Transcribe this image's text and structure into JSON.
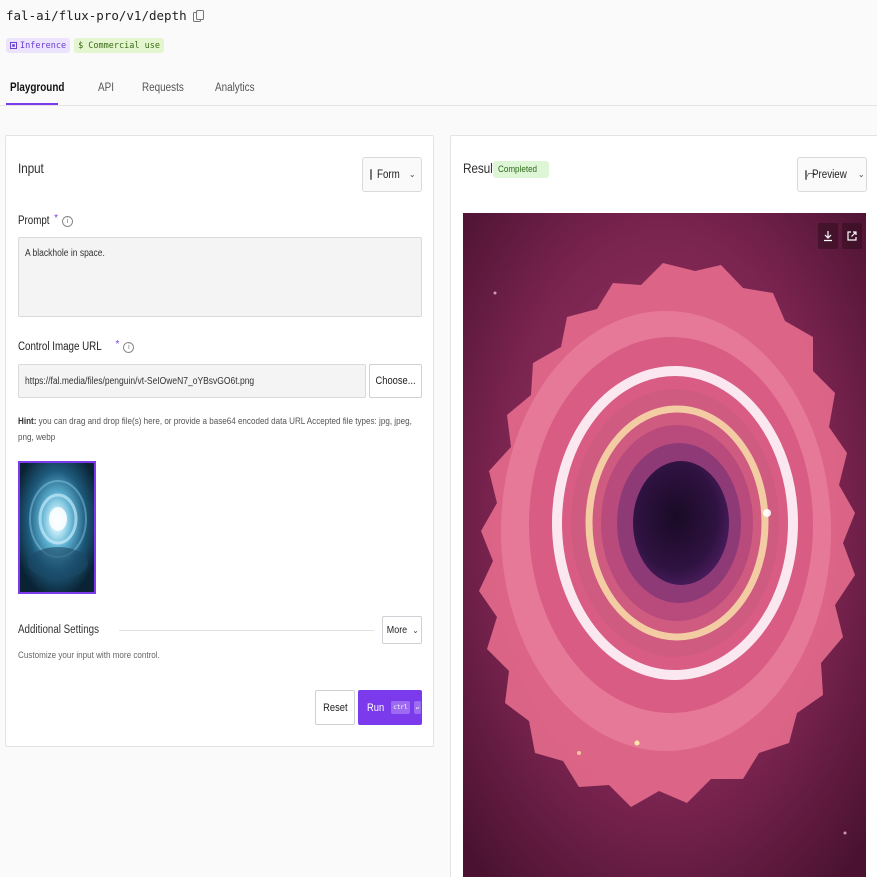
{
  "header": {
    "model_id": "fal-ai/flux-pro/v1/depth",
    "badges": {
      "inference": "Inference",
      "commercial": "$ Commercial use"
    },
    "tabs": [
      "Playground",
      "API",
      "Requests",
      "Analytics"
    ],
    "active_tab": "Playground"
  },
  "input": {
    "title": "Input",
    "view_select": "Form",
    "prompt": {
      "label": "Prompt",
      "required_mark": "*",
      "value": "A blackhole in space."
    },
    "control_image": {
      "label": "Control Image URL",
      "required_mark": "*",
      "value": "https://fal.media/files/penguin/vt-SeIOweN7_oYBsvGO6t.png",
      "choose_label": "Choose..."
    },
    "hint": {
      "bold": "Hint:",
      "text": " you can drag and drop file(s) here, or provide a base64 encoded data URL Accepted file types: jpg, jpeg, png, webp"
    },
    "additional_settings": {
      "label": "Additional Settings",
      "more_label": "More",
      "description": "Customize your input with more control."
    },
    "reset_label": "Reset",
    "run_label": "Run",
    "run_shortcut": "ctrl"
  },
  "result": {
    "title": "Result",
    "status": "Completed",
    "view_select": "Preview"
  },
  "colors": {
    "accent": "#7c3aed",
    "status_green_bg": "#def5d6",
    "inference_bg": "#ece3fd",
    "commercial_bg": "#e4f6cf"
  },
  "icons": [
    "copy-icon",
    "form-icon",
    "image-icon",
    "info-icon",
    "chevron-down-icon",
    "download-icon",
    "external-link-icon",
    "enter-icon"
  ]
}
